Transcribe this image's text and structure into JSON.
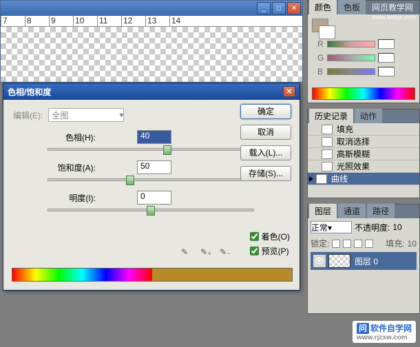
{
  "ruler": [
    "7",
    "8",
    "9",
    "10",
    "11",
    "12",
    "13",
    "14"
  ],
  "color_panel": {
    "tab_color": "颜色",
    "tab_swatch": "色板",
    "r": "R",
    "g": "G",
    "b": "B"
  },
  "history_panel": {
    "tab_history": "历史记录",
    "tab_actions": "动作",
    "items": [
      "填充",
      "取消选择",
      "高斯模糊",
      "光照效果",
      "曲线"
    ]
  },
  "layers_panel": {
    "tab_layers": "图层",
    "tab_channels": "通道",
    "tab_paths": "路径",
    "blend_mode": "正常",
    "opacity_label": "不透明度:",
    "opacity_value": "10",
    "lock_label": "锁定:",
    "fill_label": "填充:",
    "fill_value": "10",
    "layer0": "图层 0"
  },
  "dialog": {
    "title": "色相/饱和度",
    "edit_label": "编辑(E):",
    "edit_value": "全图",
    "hue_label": "色相(H):",
    "hue_value": "40",
    "sat_label": "饱和度(A):",
    "sat_value": "50",
    "light_label": "明度(I):",
    "light_value": "0",
    "ok": "确定",
    "cancel": "取消",
    "load": "载入(L)...",
    "save": "存储(S)...",
    "colorize": "着色(O)",
    "preview": "预览(P)"
  },
  "watermark1": "网页教学网",
  "watermark1_url": "www.webjx.com",
  "watermark2": "软件自学网",
  "watermark2_url": "www.rjzxw.com"
}
